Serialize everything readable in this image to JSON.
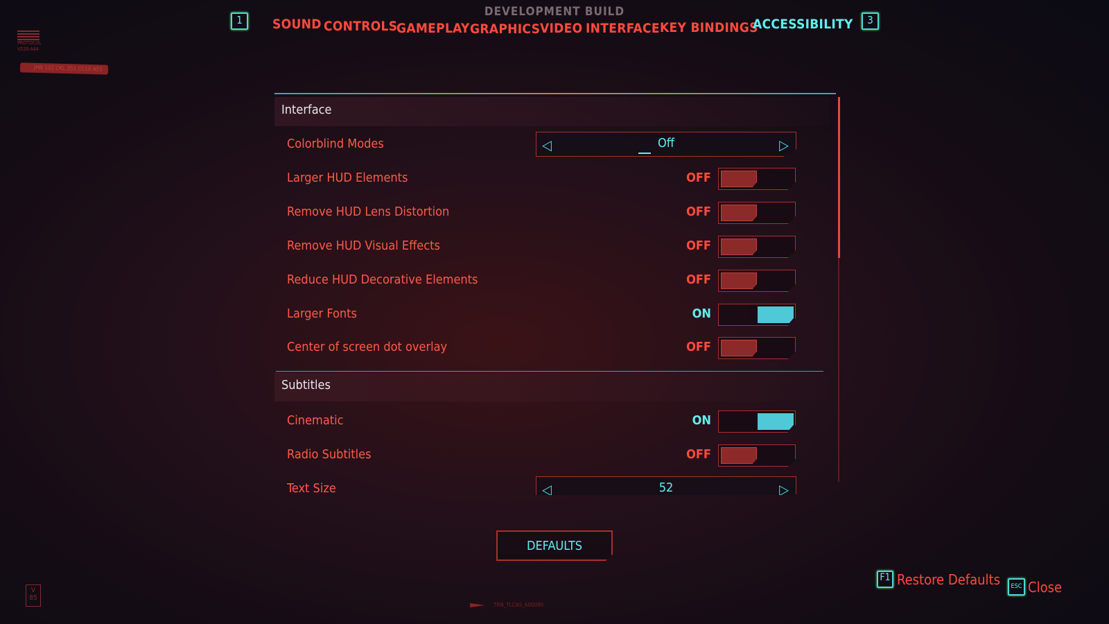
{
  "header": {
    "build": "DEVELOPMENT BUILD",
    "left_key": "1",
    "right_key": "3",
    "tabs": [
      {
        "label": "SOUND"
      },
      {
        "label": "CONTROLS"
      },
      {
        "label": "GAMEPLAY"
      },
      {
        "label": "GRAPHICS"
      },
      {
        "label": "VIDEO"
      },
      {
        "label": "INTERFACE"
      },
      {
        "label": "KEY BINDINGS"
      },
      {
        "label": "ACCESSIBILITY",
        "active": true
      }
    ]
  },
  "deco": {
    "protocol": "PROTOCOL",
    "code": "V520-A44",
    "badge": "JHN 102 CKL 351 CC10 A55",
    "footer_id": "TRN_TLCAS_600095",
    "version": "V 85"
  },
  "sections": [
    {
      "title": "Interface",
      "rows": [
        {
          "label": "Colorblind Modes",
          "type": "selector",
          "value": "Off"
        },
        {
          "label": "Larger HUD Elements",
          "type": "toggle",
          "state": "OFF"
        },
        {
          "label": "Remove HUD Lens Distortion",
          "type": "toggle",
          "state": "OFF"
        },
        {
          "label": "Remove HUD Visual Effects",
          "type": "toggle",
          "state": "OFF"
        },
        {
          "label": "Reduce HUD Decorative Elements",
          "type": "toggle",
          "state": "OFF"
        },
        {
          "label": "Larger Fonts",
          "type": "toggle",
          "state": "ON"
        },
        {
          "label": "Center of screen dot overlay",
          "type": "toggle",
          "state": "OFF"
        }
      ]
    },
    {
      "title": "Subtitles",
      "rows": [
        {
          "label": "Cinematic",
          "type": "toggle",
          "state": "ON"
        },
        {
          "label": "Radio Subtitles",
          "type": "toggle",
          "state": "OFF"
        },
        {
          "label": "Text Size",
          "type": "selector",
          "value": "52"
        }
      ]
    }
  ],
  "defaults_button": "DEFAULTS",
  "footer": {
    "restore_key": "F1",
    "restore_label": "Restore Defaults",
    "close_key": "ESC",
    "close_label": "Close"
  },
  "colors": {
    "accent_red": "#ff4a3c",
    "accent_cyan": "#5ff0f0",
    "off_fill": "#8c2a2a",
    "on_fill": "#4fc8d8"
  }
}
